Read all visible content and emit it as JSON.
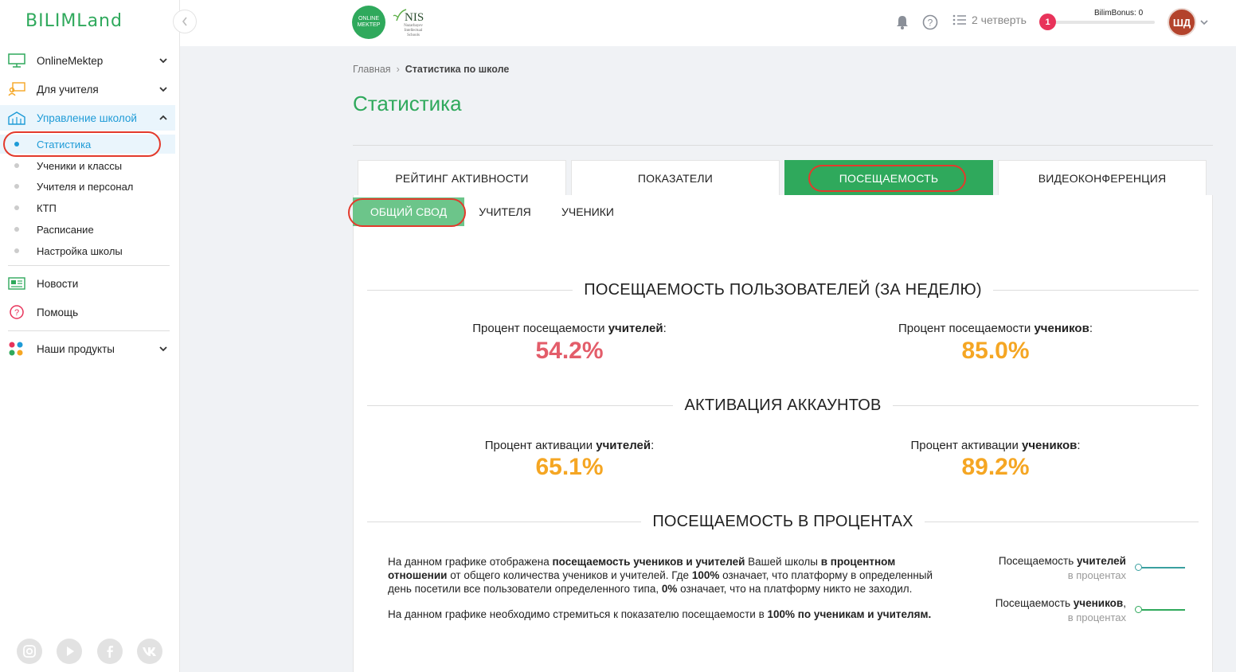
{
  "brand": {
    "logo": "BILIMLand",
    "om_logo_line1": "ONLINE",
    "om_logo_line2": "MEKTEP",
    "nis": "NIS",
    "nis_sub": "Nazarbayev Intellectual Schools"
  },
  "sidebar": {
    "items": [
      {
        "label": "OnlineMektep"
      },
      {
        "label": "Для учителя"
      },
      {
        "label": "Управление школой"
      }
    ],
    "sub_items": [
      {
        "label": "Статистика"
      },
      {
        "label": "Ученики и классы"
      },
      {
        "label": "Учителя и персонал"
      },
      {
        "label": "КТП"
      },
      {
        "label": "Расписание"
      },
      {
        "label": "Настройка школы"
      }
    ],
    "bottom_items": [
      {
        "label": "Новости"
      },
      {
        "label": "Помощь"
      },
      {
        "label": "Наши продукты"
      }
    ]
  },
  "header": {
    "quarter": "2 четверть",
    "notifications_count": "1",
    "bonus": "BilimBonus: 0",
    "avatar": "ШД"
  },
  "breadcrumb": {
    "home": "Главная",
    "current": "Статистика по школе"
  },
  "page_title": "Статистика",
  "tabs": [
    {
      "label": "РЕЙТИНГ АКТИВНОСТИ"
    },
    {
      "label": "ПОКАЗАТЕЛИ"
    },
    {
      "label": "ПОСЕЩАЕМОСТЬ"
    },
    {
      "label": "ВИДЕОКОНФЕРЕНЦИЯ"
    }
  ],
  "subtabs": [
    {
      "label": "ОБЩИЙ СВОД"
    },
    {
      "label": "УЧИТЕЛЯ"
    },
    {
      "label": "УЧЕНИКИ"
    }
  ],
  "sections": {
    "attendance": {
      "title": "ПОСЕЩАЕМОСТЬ ПОЛЬЗОВАТЕЛЕЙ (ЗА НЕДЕЛЮ)",
      "teachers_label_pre": "Процент посещаемости ",
      "teachers_label_bold": "учителей",
      "teachers_label_post": ":",
      "teachers_value": "54.2%",
      "students_label_pre": "Процент посещаемости ",
      "students_label_bold": "учеников",
      "students_label_post": ":",
      "students_value": "85.0%"
    },
    "activation": {
      "title": "АКТИВАЦИЯ АККАУНТОВ",
      "teachers_label_pre": "Процент активации ",
      "teachers_label_bold": "учителей",
      "teachers_label_post": ":",
      "teachers_value": "65.1%",
      "students_label_pre": "Процент активации ",
      "students_label_bold": "учеников",
      "students_label_post": ":",
      "students_value": "89.2%"
    },
    "percent": {
      "title": "ПОСЕЩАЕМОСТЬ В ПРОЦЕНТАХ",
      "p1_a": "На данном графике отображена ",
      "p1_b": "посещаемость учеников и учителей",
      "p1_c": " Вашей школы ",
      "p1_d": "в процентном отношении",
      "p1_e": " от общего количества учеников и учителей. Где ",
      "p1_f": "100%",
      "p1_g": " означает, что платформу в определенный день посетили все пользователи определенного типа, ",
      "p1_h": "0%",
      "p1_i": " означает, что на платформу никто не заходил.",
      "p2_a": "На данном графике необходимо стремиться к показателю посещаемости в ",
      "p2_b": "100% по ученикам и учителям.",
      "legend_teachers_pre": "Посещаемость ",
      "legend_teachers_bold": "учителей",
      "legend_teachers_sub": "в процентах",
      "legend_students_pre": "Посещаемость ",
      "legend_students_bold": "учеников",
      "legend_students_post": ",",
      "legend_students_sub": "в процентах"
    }
  },
  "colors": {
    "brand_green": "#2fa95c",
    "active_blue": "#1e9bd7",
    "value_red": "#e35d6a",
    "value_orange": "#f5a623",
    "legend_teachers": "#3aa0a0",
    "legend_students": "#2fa95c",
    "annotation": "#e33a2c"
  }
}
